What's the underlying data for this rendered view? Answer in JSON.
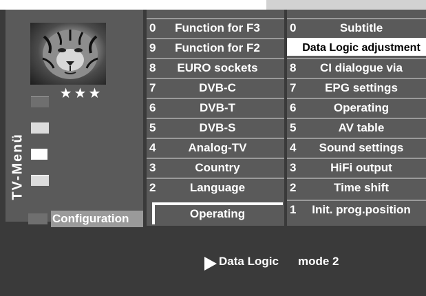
{
  "menu": {
    "title": "TV-Menü",
    "rating": "★★★",
    "current_section": "Configuration"
  },
  "middle_column": {
    "items": [
      {
        "num": "0",
        "label": "Function for F3"
      },
      {
        "num": "9",
        "label": "Function for F2"
      },
      {
        "num": "8",
        "label": "EURO sockets"
      },
      {
        "num": "7",
        "label": "DVB-C"
      },
      {
        "num": "6",
        "label": "DVB-T"
      },
      {
        "num": "5",
        "label": "DVB-S"
      },
      {
        "num": "4",
        "label": "Analog-TV"
      },
      {
        "num": "3",
        "label": "Country"
      },
      {
        "num": "2",
        "label": "Language"
      },
      {
        "num": "",
        "label": "Operating"
      }
    ],
    "selected": "Operating"
  },
  "right_column": {
    "items": [
      {
        "num": "0",
        "label": "Subtitle"
      },
      {
        "num": "",
        "label": "Data Logic adjustment"
      },
      {
        "num": "8",
        "label": "CI dialogue via"
      },
      {
        "num": "7",
        "label": "EPG settings"
      },
      {
        "num": "6",
        "label": "Operating"
      },
      {
        "num": "5",
        "label": "AV table"
      },
      {
        "num": "4",
        "label": "Sound settings"
      },
      {
        "num": "3",
        "label": "HiFi output"
      },
      {
        "num": "2",
        "label": "Time shift"
      },
      {
        "num": "1",
        "label": "Init. prog.position"
      }
    ],
    "highlighted": "Data Logic adjustment"
  },
  "info_bar": {
    "label": "Data Logic",
    "value": "mode 2"
  },
  "colors": {
    "background": "#3a3a3a",
    "panel": "#5a5a5a",
    "text": "#ffffff",
    "highlight": "#ffffff"
  }
}
